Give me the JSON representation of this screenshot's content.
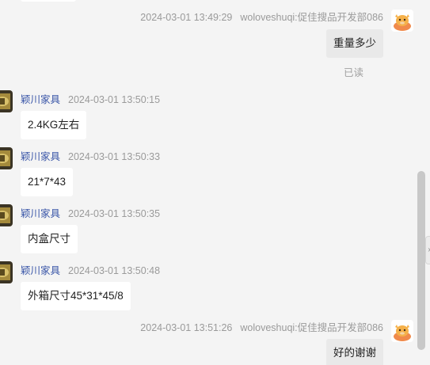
{
  "colors": {
    "background": "#f4f4f4",
    "incoming_bubble": "#ffffff",
    "outgoing_bubble": "#e9e9e9",
    "sender_name": "#3a56a8",
    "meta_text": "#9a9a9a",
    "scrollbar_thumb": "#c8c8c8"
  },
  "messages": [
    {
      "direction": "outgoing",
      "time": "2024-03-01 13:49:29",
      "sender": "woloveshuqi:促佳搜品开发部086",
      "text": "重量多少",
      "status": "已读",
      "avatar_icon": "cartoon-cow-avatar-icon"
    },
    {
      "direction": "incoming",
      "sender": "颖川家具",
      "time": "2024-03-01 13:50:15",
      "text": "2.4KG左右",
      "avatar_icon": "shop-avatar-icon"
    },
    {
      "direction": "incoming",
      "sender": "颖川家具",
      "time": "2024-03-01 13:50:33",
      "text": "21*7*43",
      "avatar_icon": "shop-avatar-icon"
    },
    {
      "direction": "incoming",
      "sender": "颖川家具",
      "time": "2024-03-01 13:50:35",
      "text": "内盒尺寸",
      "avatar_icon": "shop-avatar-icon"
    },
    {
      "direction": "incoming",
      "sender": "颖川家具",
      "time": "2024-03-01 13:50:48",
      "text": "外箱尺寸45*31*45/8",
      "avatar_icon": "shop-avatar-icon"
    },
    {
      "direction": "outgoing",
      "time": "2024-03-01 13:51:26",
      "sender": "woloveshuqi:促佳搜品开发部086",
      "text": "好的谢谢",
      "avatar_icon": "cartoon-cow-avatar-icon"
    }
  ],
  "scrollbar": {
    "expand_icon": "chevron-right-icon",
    "expand_glyph": "›"
  }
}
